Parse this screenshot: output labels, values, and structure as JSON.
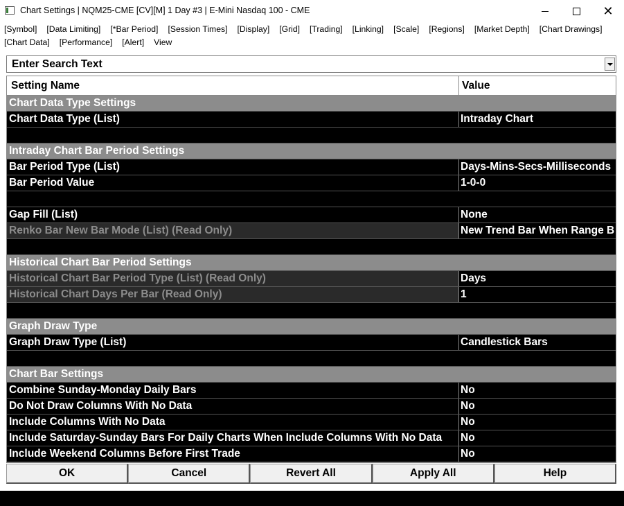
{
  "window": {
    "title": "Chart Settings | NQM25-CME [CV][M]  1 Day  #3 | E-Mini Nasdaq 100 - CME"
  },
  "menu": {
    "row1": [
      "[Symbol]",
      "[Data Limiting]",
      "[*Bar Period]",
      "[Session Times]",
      "[Display]",
      "[Grid]",
      "[Trading]",
      "[Linking]",
      "[Scale]",
      "[Regions]",
      "[Market Depth]",
      "[Chart Drawings]"
    ],
    "row2": [
      "[Chart Data]",
      "[Performance]",
      "[Alert]",
      "View"
    ]
  },
  "search": {
    "placeholder": "Enter Search Text"
  },
  "grid": {
    "header_name": "Setting Name",
    "header_value": "Value",
    "rows": [
      {
        "kind": "section",
        "label": "Chart Data Type Settings"
      },
      {
        "kind": "setting",
        "name": "Chart Data Type (List)",
        "value": "Intraday Chart"
      },
      {
        "kind": "blank"
      },
      {
        "kind": "section",
        "label": "Intraday Chart Bar Period Settings"
      },
      {
        "kind": "setting",
        "name": "Bar Period Type (List)",
        "value": "Days-Mins-Secs-Milliseconds"
      },
      {
        "kind": "setting",
        "name": "Bar Period Value",
        "value": "1-0-0"
      },
      {
        "kind": "blank"
      },
      {
        "kind": "setting",
        "name": "Gap Fill (List)",
        "value": "None"
      },
      {
        "kind": "readonly",
        "name": "Renko Bar New Bar Mode (List) (Read Only)",
        "value": "New Trend Bar When Range B"
      },
      {
        "kind": "blank"
      },
      {
        "kind": "section",
        "label": "Historical Chart Bar Period Settings"
      },
      {
        "kind": "readonly",
        "name": "Historical Chart Bar Period Type (List) (Read Only)",
        "value": "Days"
      },
      {
        "kind": "readonly",
        "name": "Historical Chart Days Per Bar (Read Only)",
        "value": "1"
      },
      {
        "kind": "blank"
      },
      {
        "kind": "section",
        "label": "Graph Draw Type"
      },
      {
        "kind": "setting",
        "name": "Graph Draw Type (List)",
        "value": "Candlestick Bars"
      },
      {
        "kind": "blank"
      },
      {
        "kind": "section",
        "label": "Chart Bar Settings"
      },
      {
        "kind": "setting",
        "name": "Combine Sunday-Monday Daily Bars",
        "value": "No"
      },
      {
        "kind": "setting",
        "name": "Do Not Draw Columns With No Data",
        "value": "No"
      },
      {
        "kind": "setting",
        "name": "Include Columns With No Data",
        "value": "No"
      },
      {
        "kind": "setting",
        "name": "Include Saturday-Sunday Bars For Daily Charts When Include Columns With No Data",
        "value": "No"
      },
      {
        "kind": "setting",
        "name": "Include Weekend Columns Before First Trade",
        "value": "No"
      }
    ]
  },
  "buttons": {
    "ok": "OK",
    "cancel": "Cancel",
    "revert_all": "Revert All",
    "apply_all": "Apply All",
    "help": "Help"
  },
  "colors": {
    "section_bg": "#8c8c8c",
    "row_bg": "#000000",
    "readonly_text": "#8c8c8c"
  }
}
